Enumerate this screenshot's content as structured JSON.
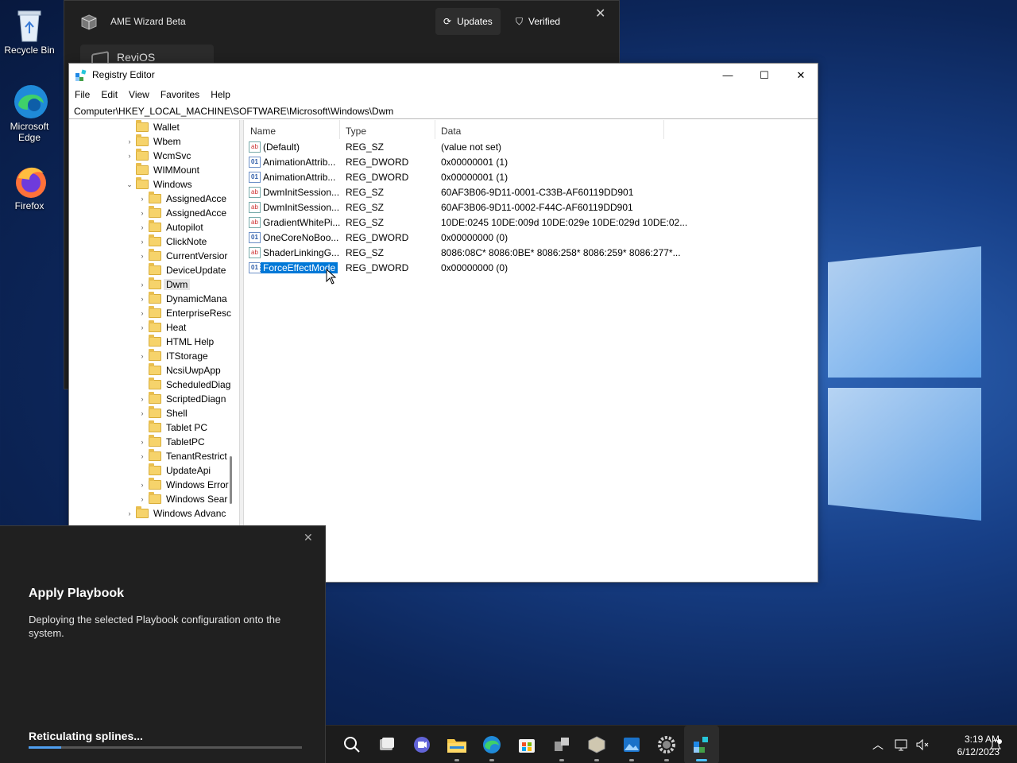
{
  "desktop": {
    "icons": [
      {
        "label": "Recycle Bin"
      },
      {
        "label_line1": "Microsoft",
        "label_line2": "Edge"
      },
      {
        "label": "Firefox"
      }
    ]
  },
  "ame": {
    "title": "AME Wizard Beta",
    "updates_label": "Updates",
    "verified_label": "Verified",
    "playbook_name": "ReviOS"
  },
  "regedit": {
    "title": "Registry Editor",
    "menu": [
      "File",
      "Edit",
      "View",
      "Favorites",
      "Help"
    ],
    "address": "Computer\\HKEY_LOCAL_MACHINE\\SOFTWARE\\Microsoft\\Windows\\Dwm",
    "tree": [
      {
        "label": "Wallet",
        "level": 0,
        "chev": ""
      },
      {
        "label": "Wbem",
        "level": 0,
        "chev": "›"
      },
      {
        "label": "WcmSvc",
        "level": 0,
        "chev": "›"
      },
      {
        "label": "WIMMount",
        "level": 0,
        "chev": ""
      },
      {
        "label": "Windows",
        "level": 0,
        "chev": "⌄"
      },
      {
        "label": "AssignedAcce",
        "level": 1,
        "chev": "›"
      },
      {
        "label": "AssignedAcce",
        "level": 1,
        "chev": "›"
      },
      {
        "label": "Autopilot",
        "level": 1,
        "chev": "›"
      },
      {
        "label": "ClickNote",
        "level": 1,
        "chev": "›"
      },
      {
        "label": "CurrentVersior",
        "level": 1,
        "chev": "›"
      },
      {
        "label": "DeviceUpdate",
        "level": 1,
        "chev": ""
      },
      {
        "label": "Dwm",
        "level": 1,
        "chev": "›",
        "selected": true
      },
      {
        "label": "DynamicMana",
        "level": 1,
        "chev": "›"
      },
      {
        "label": "EnterpriseResc",
        "level": 1,
        "chev": "›"
      },
      {
        "label": "Heat",
        "level": 1,
        "chev": "›"
      },
      {
        "label": "HTML Help",
        "level": 1,
        "chev": ""
      },
      {
        "label": "ITStorage",
        "level": 1,
        "chev": "›"
      },
      {
        "label": "NcsiUwpApp",
        "level": 1,
        "chev": ""
      },
      {
        "label": "ScheduledDiag",
        "level": 1,
        "chev": ""
      },
      {
        "label": "ScriptedDiagn",
        "level": 1,
        "chev": "›"
      },
      {
        "label": "Shell",
        "level": 1,
        "chev": "›"
      },
      {
        "label": "Tablet PC",
        "level": 1,
        "chev": ""
      },
      {
        "label": "TabletPC",
        "level": 1,
        "chev": "›"
      },
      {
        "label": "TenantRestrict",
        "level": 1,
        "chev": "›"
      },
      {
        "label": "UpdateApi",
        "level": 1,
        "chev": ""
      },
      {
        "label": "Windows Error",
        "level": 1,
        "chev": "›"
      },
      {
        "label": "Windows Sear",
        "level": 1,
        "chev": "›"
      },
      {
        "label": "Windows Advanc",
        "level": 0,
        "chev": "›"
      }
    ],
    "columns": {
      "name": "Name",
      "type": "Type",
      "data": "Data"
    },
    "values": [
      {
        "name": "(Default)",
        "type": "REG_SZ",
        "data": "(value not set)",
        "kind": "sz"
      },
      {
        "name": "AnimationAttrib...",
        "type": "REG_DWORD",
        "data": "0x00000001 (1)",
        "kind": "dword"
      },
      {
        "name": "AnimationAttrib...",
        "type": "REG_DWORD",
        "data": "0x00000001 (1)",
        "kind": "dword"
      },
      {
        "name": "DwmInitSession...",
        "type": "REG_SZ",
        "data": "60AF3B06-9D11-0001-C33B-AF60119DD901",
        "kind": "sz"
      },
      {
        "name": "DwmInitSession...",
        "type": "REG_SZ",
        "data": "60AF3B06-9D11-0002-F44C-AF60119DD901",
        "kind": "sz"
      },
      {
        "name": "GradientWhitePi...",
        "type": "REG_SZ",
        "data": "10DE:0245 10DE:009d 10DE:029e 10DE:029d 10DE:02...",
        "kind": "sz"
      },
      {
        "name": "OneCoreNoBoo...",
        "type": "REG_DWORD",
        "data": "0x00000000 (0)",
        "kind": "dword"
      },
      {
        "name": "ShaderLinkingG...",
        "type": "REG_SZ",
        "data": "8086:08C* 8086:0BE* 8086:258* 8086:259* 8086:277*...",
        "kind": "sz"
      },
      {
        "name": "ForceEffectMode",
        "type": "REG_DWORD",
        "data": "0x00000000 (0)",
        "kind": "dword",
        "selected": true
      }
    ]
  },
  "playbook": {
    "title": "Apply Playbook",
    "description": "Deploying the selected Playbook configuration onto the system.",
    "status": "Reticulating splines...",
    "progress": 0.12
  },
  "taskbar": {
    "icons": [
      "search-icon",
      "task-view-icon",
      "teams-chat-icon",
      "file-explorer-icon",
      "edge-icon",
      "store-icon",
      "ame-tools-icon",
      "ame-wizard-icon",
      "photos-icon",
      "settings-icon",
      "regedit-icon"
    ],
    "time": "3:19 AM",
    "date": "6/12/2023"
  },
  "colors": {
    "accent": "#0078d7",
    "progress": "#4f9ff0"
  }
}
